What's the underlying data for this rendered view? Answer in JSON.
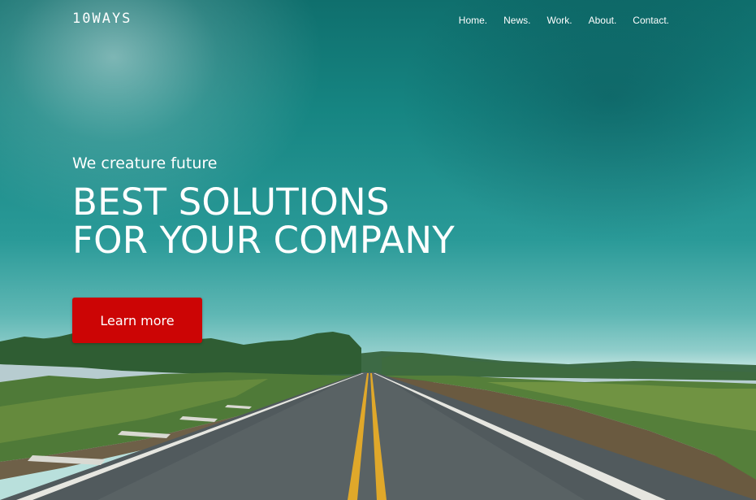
{
  "header": {
    "logo": "10WAYS",
    "nav": [
      "Home.",
      "News.",
      "Work.",
      "About.",
      "Contact."
    ]
  },
  "hero": {
    "tagline": "We creature future",
    "headline_line1": "BEST SOLUTIONS",
    "headline_line2": "FOR YOUR COMPANY",
    "cta_label": "Learn more"
  },
  "colors": {
    "cta_background": "#cc0505",
    "sky_teal": "#168582",
    "text": "#ffffff"
  }
}
